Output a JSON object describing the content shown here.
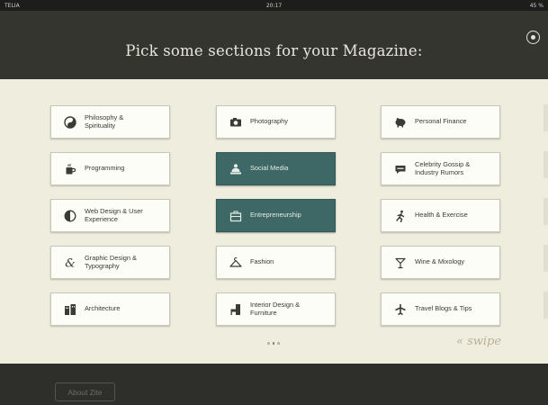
{
  "status_bar": {
    "carrier": "TELIA",
    "time": "20:17",
    "battery": "45 %"
  },
  "header": {
    "title": "Pick some sections for your Magazine:"
  },
  "sections": [
    {
      "label": "Philosophy &\nSpirituality",
      "icon": "yin-yang-icon",
      "selected": false
    },
    {
      "label": "Photography",
      "icon": "camera-icon",
      "selected": false
    },
    {
      "label": "Personal Finance",
      "icon": "piggy-bank-icon",
      "selected": false
    },
    {
      "label": "Programming",
      "icon": "coffee-mug-icon",
      "selected": false
    },
    {
      "label": "Social Media",
      "icon": "people-icon",
      "selected": true
    },
    {
      "label": "Celebrity Gossip &\nIndustry Rumors",
      "icon": "speech-bubble-icon",
      "selected": false
    },
    {
      "label": "Web Design & User\nExperience",
      "icon": "half-moon-icon",
      "selected": false
    },
    {
      "label": "Entrepreneurship",
      "icon": "briefcase-icon",
      "selected": true
    },
    {
      "label": "Health & Exercise",
      "icon": "runner-icon",
      "selected": false
    },
    {
      "label": "Graphic Design &\nTypography",
      "icon": "ampersand-icon",
      "selected": false
    },
    {
      "label": "Fashion",
      "icon": "hanger-icon",
      "selected": false
    },
    {
      "label": "Wine & Mixology",
      "icon": "cocktail-glass-icon",
      "selected": false
    },
    {
      "label": "Architecture",
      "icon": "building-icon",
      "selected": false
    },
    {
      "label": "Interior Design &\nFurniture",
      "icon": "chair-icon",
      "selected": false
    },
    {
      "label": "Travel Blogs & Tips",
      "icon": "airplane-icon",
      "selected": false
    }
  ],
  "pagination": {
    "count": 3,
    "current": 1
  },
  "swipe_hint": "« swipe",
  "footer": {
    "about_label": "About Zite"
  },
  "colors": {
    "header_bg": "#34352f",
    "content_bg": "#eeedde",
    "selected_tile": "#3e6866",
    "tile_bg": "#fdfdf7"
  }
}
